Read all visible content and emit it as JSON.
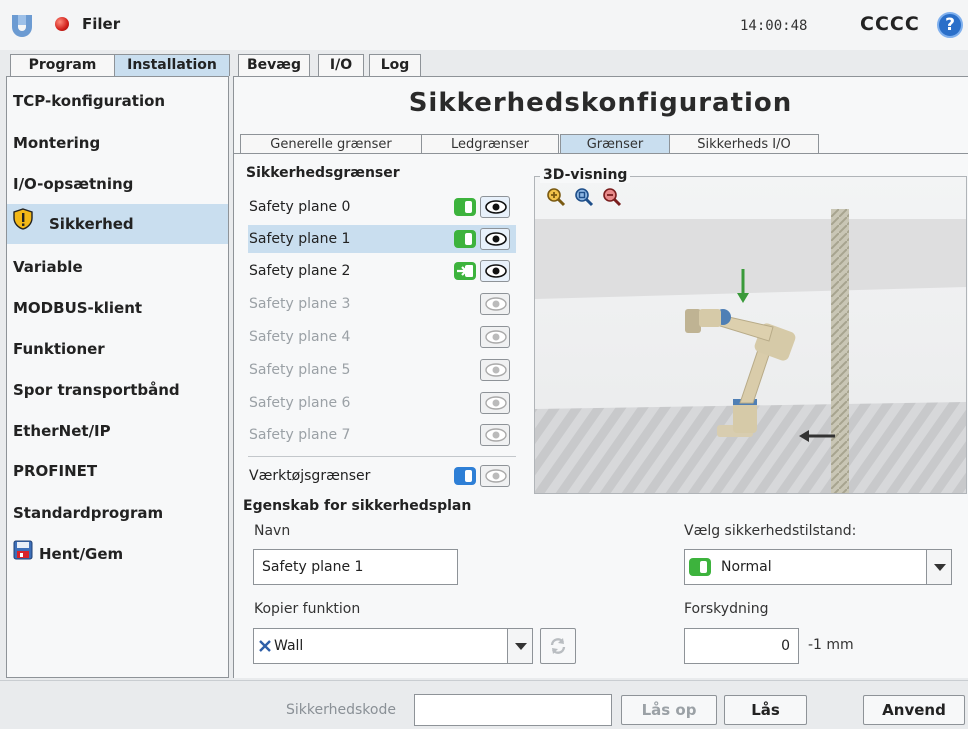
{
  "topbar": {
    "menu_label": "Filer",
    "time": "14:00:48",
    "robot_name": "CCCC",
    "help_symbol": "?"
  },
  "main_tabs": [
    {
      "label": "Program"
    },
    {
      "label": "Installation"
    },
    {
      "label": "Bevæg"
    },
    {
      "label": "I/O"
    },
    {
      "label": "Log"
    }
  ],
  "sidebar": {
    "items": [
      {
        "label": "TCP-konfiguration"
      },
      {
        "label": "Montering"
      },
      {
        "label": "I/O-opsætning"
      },
      {
        "label": "Sikkerhed"
      },
      {
        "label": "Variable"
      },
      {
        "label": "MODBUS-klient"
      },
      {
        "label": "Funktioner"
      },
      {
        "label": "Spor transportbånd"
      },
      {
        "label": "EtherNet/IP"
      },
      {
        "label": "PROFINET"
      },
      {
        "label": "Standardprogram"
      },
      {
        "label": "Hent/Gem"
      }
    ]
  },
  "page": {
    "title": "Sikkerhedskonfiguration"
  },
  "sub_tabs": [
    {
      "label": "Generelle grænser"
    },
    {
      "label": "Ledgrænser"
    },
    {
      "label": "Grænser"
    },
    {
      "label": "Sikkerheds I/O"
    }
  ],
  "limits": {
    "title": "Sikkerhedsgrænser",
    "planes": [
      {
        "label": "Safety plane 0"
      },
      {
        "label": "Safety plane 1"
      },
      {
        "label": "Safety plane 2"
      },
      {
        "label": "Safety plane 3"
      },
      {
        "label": "Safety plane 4"
      },
      {
        "label": "Safety plane 5"
      },
      {
        "label": "Safety plane 6"
      },
      {
        "label": "Safety plane 7"
      }
    ],
    "tool_limits_label": "Værktøjsgrænser"
  },
  "view3d": {
    "title": "3D-visning"
  },
  "plane_props": {
    "title": "Egenskab for sikkerhedsplan",
    "name_label": "Navn",
    "name_value": "Safety plane 1",
    "copy_label": "Kopier funktion",
    "copy_value": "Wall",
    "mode_label": "Vælg sikkerhedstilstand:",
    "mode_value": "Normal",
    "offset_label": "Forskydning",
    "offset_value": "0",
    "offset_unit": "-1 mm"
  },
  "bottombar": {
    "safety_code_label": "Sikkerhedskode",
    "unlock_label": "Lås op",
    "lock_label": "Lås",
    "apply_label": "Anvend"
  },
  "colors": {
    "selection": "#c9deef",
    "toggle_green": "#3db33d",
    "toggle_blue": "#2e7fd6"
  }
}
